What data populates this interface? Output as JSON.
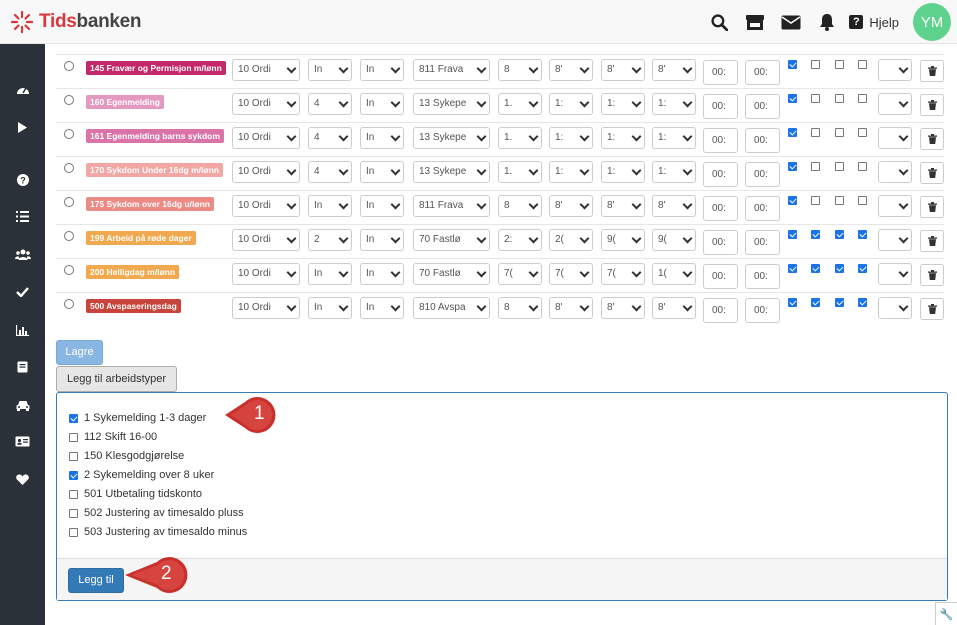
{
  "app": {
    "logo_text_a": "Tids",
    "logo_text_b": "banken"
  },
  "topbar": {
    "help_label": "Hjelp",
    "avatar_initials": "YM"
  },
  "sidebar": {
    "icons": [
      "dashboard-icon",
      "play-icon",
      "question-icon",
      "list-icon",
      "users-icon",
      "check-icon",
      "chart-icon",
      "book-icon",
      "car-icon",
      "id-card-icon",
      "heart-icon"
    ]
  },
  "rows": [
    {
      "label": "145 Fravær og Permisjon m/lønn",
      "color": "#c2286a",
      "cells": [
        "10 Ordi",
        "In",
        "In",
        "811 Frava",
        "8",
        "8'",
        "8'",
        "8'"
      ],
      "t1": "00:",
      "t2": "00:",
      "checks": [
        true,
        false,
        false,
        false
      ]
    },
    {
      "label": "160 Egenmelding",
      "color": "#e49ac0",
      "cells": [
        "10 Ordi",
        "4",
        "In",
        "13 Sykepe",
        "1.",
        "1:",
        "1:",
        "1:"
      ],
      "t1": "00:",
      "t2": "00:",
      "checks": [
        true,
        false,
        false,
        false
      ]
    },
    {
      "label": "161 Egenmelding barns sykdom",
      "color": "#d973a8",
      "cells": [
        "10 Ordi",
        "4",
        "In",
        "13 Sykepe",
        "1.",
        "1:",
        "1:",
        "1:"
      ],
      "t1": "00:",
      "t2": "00:",
      "checks": [
        true,
        false,
        false,
        false
      ]
    },
    {
      "label": "170 Sykdom Under 16dg m/lønn",
      "color": "#f2a7a4",
      "cells": [
        "10 Ordi",
        "4",
        "In",
        "13 Sykepe",
        "1.",
        "1:",
        "1:",
        "1:"
      ],
      "t1": "00:",
      "t2": "00:",
      "checks": [
        true,
        false,
        false,
        false
      ]
    },
    {
      "label": "175 Sykdom over 16dg u/lønn",
      "color": "#ec8a86",
      "cells": [
        "10 Ordi",
        "In",
        "In",
        "811 Frava",
        "8",
        "8'",
        "8'",
        "8'"
      ],
      "t1": "00:",
      "t2": "00:",
      "checks": [
        true,
        false,
        false,
        false
      ]
    },
    {
      "label": "199 Arbeid på røde dager",
      "color": "#f0a94e",
      "cells": [
        "10 Ordi",
        "2",
        "In",
        "70 Fastlø",
        "2:",
        "2(",
        "9(",
        "9("
      ],
      "t1": "00:",
      "t2": "00:",
      "checks": [
        true,
        true,
        true,
        true
      ]
    },
    {
      "label": "200 Helligdag m/lønn",
      "color": "#f0a94e",
      "cells": [
        "10 Ordi",
        "In",
        "In",
        "70 Fastlø",
        "7(",
        "7(",
        "7(",
        "1("
      ],
      "t1": "00:",
      "t2": "00:",
      "checks": [
        true,
        true,
        true,
        true
      ]
    },
    {
      "label": "500 Avspaseringsdag",
      "color": "#c8433a",
      "cells": [
        "10 Ordi",
        "In",
        "In",
        "810 Avspa",
        "8",
        "8'",
        "8'",
        "8'"
      ],
      "t1": "00:",
      "t2": "00:",
      "checks": [
        true,
        true,
        true,
        true
      ]
    }
  ],
  "buttons": {
    "save": "Lagre",
    "add_work_types": "Legg til arbeidstyper",
    "add": "Legg til"
  },
  "options": [
    {
      "label": "1 Sykemelding 1-3 dager",
      "checked": true
    },
    {
      "label": "112 Skift 16-00",
      "checked": false
    },
    {
      "label": "150 Klesgodgjørelse",
      "checked": false
    },
    {
      "label": "2 Sykemelding over 8 uker",
      "checked": true
    },
    {
      "label": "501 Utbetaling tidskonto",
      "checked": false
    },
    {
      "label": "502 Justering av timesaldo pluss",
      "checked": false
    },
    {
      "label": "503 Justering av timesaldo minus",
      "checked": false
    }
  ],
  "callouts": {
    "one": "1",
    "two": "2"
  },
  "colors": {
    "sidebar": "#2b3138",
    "primary": "#337ab7",
    "callout": "#c9302c",
    "avatar": "#5fd38d"
  }
}
